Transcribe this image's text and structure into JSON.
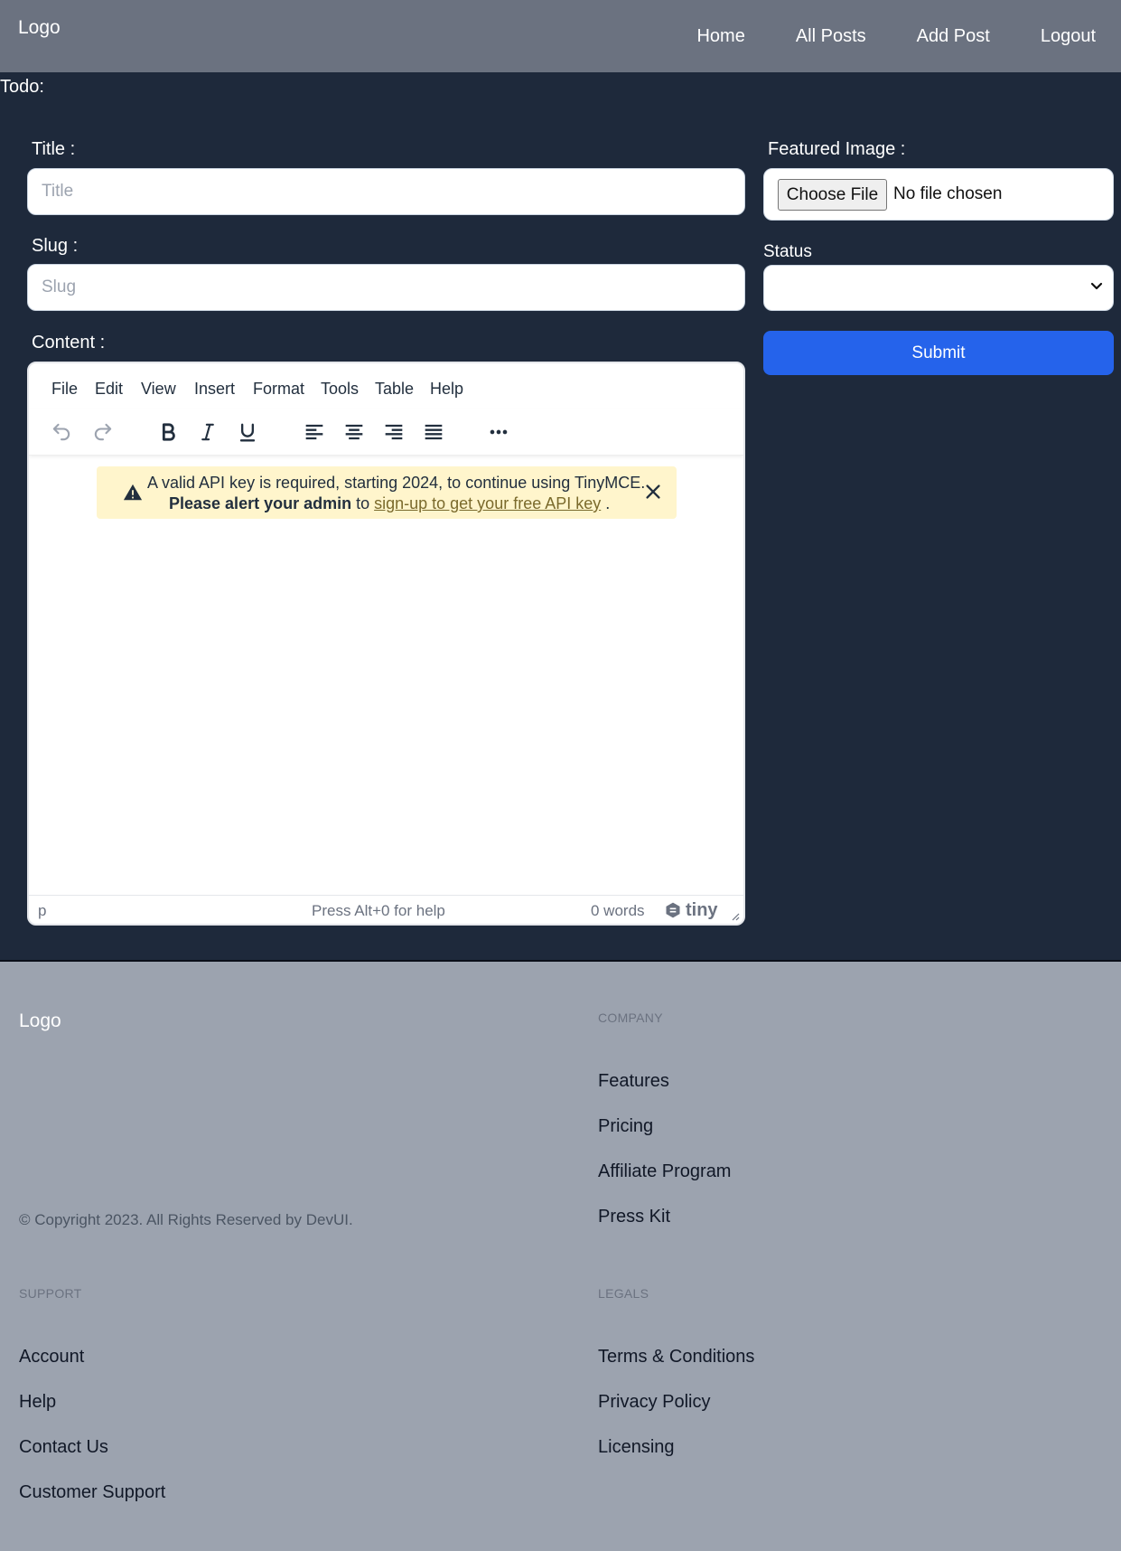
{
  "header": {
    "logo": "Logo",
    "nav": [
      "Home",
      "All Posts",
      "Add Post",
      "Logout"
    ]
  },
  "main": {
    "todo": "Todo:",
    "title_label": "Title :",
    "title_placeholder": "Title",
    "slug_label": "Slug :",
    "slug_placeholder": "Slug",
    "content_label": "Content :",
    "featured_label": "Featured Image :",
    "choose_file": "Choose File",
    "no_file": "No file chosen",
    "status_label": "Status",
    "status_value": "",
    "submit": "Submit"
  },
  "editor": {
    "menu": [
      "File",
      "Edit",
      "View",
      "Insert",
      "Format",
      "Tools",
      "Table",
      "Help"
    ],
    "toolbar_icons": [
      "undo-icon",
      "redo-icon",
      "bold-icon",
      "italic-icon",
      "underline-icon",
      "align-left-icon",
      "align-center-icon",
      "align-right-icon",
      "align-justify-icon",
      "more-icon"
    ],
    "notice_line1": "A valid API key is required, starting 2024, to continue using TinyMCE.",
    "notice_bold": "Please alert your admin",
    "notice_to": " to ",
    "notice_link": "sign-up to get your free API key",
    "notice_end": " .",
    "status_path": "p",
    "status_help": "Press Alt+0 for help",
    "status_words": "0 words",
    "brand": "tiny"
  },
  "footer": {
    "logo": "Logo",
    "copyright": "© Copyright 2023. All Rights Reserved by DevUI.",
    "company_heading": "COMPANY",
    "company_links": [
      "Features",
      "Pricing",
      "Affiliate Program",
      "Press Kit"
    ],
    "support_heading": "SUPPORT",
    "support_links": [
      "Account",
      "Help",
      "Contact Us",
      "Customer Support"
    ],
    "legals_heading": "LEGALS",
    "legals_links": [
      "Terms & Conditions",
      "Privacy Policy",
      "Licensing"
    ]
  },
  "colors": {
    "header_bg": "#6b7280",
    "main_bg": "#1e293b",
    "footer_bg": "#9ca3af",
    "submit_bg": "#2563eb",
    "notice_bg": "#fff5cc"
  }
}
